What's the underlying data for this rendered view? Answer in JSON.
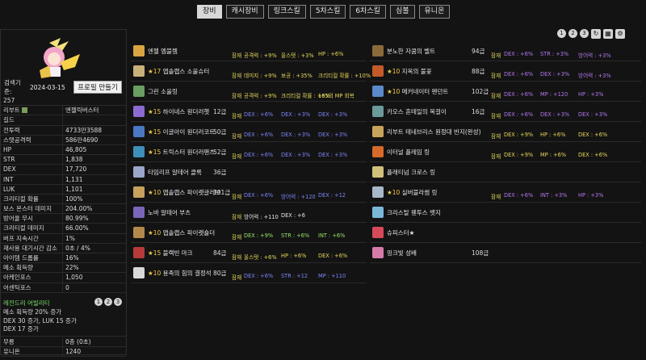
{
  "tabs": [
    "장비",
    "캐시장비",
    "링크스킬",
    "5차스킬",
    "6차스킬",
    "심볼",
    "유니온"
  ],
  "active_tab": 0,
  "search": {
    "label": "검색기준:",
    "date": "2024-03-15"
  },
  "profile_button": "프로필 만들기",
  "stats": [
    {
      "k": "257",
      "v": "",
      "single": true
    },
    {
      "k": "리부트",
      "v": "엔젤릭버스터",
      "emblem": true
    },
    {
      "k": "길드",
      "v": ""
    },
    {
      "k": "전투력",
      "v": "4733만3588"
    },
    {
      "k": "스탯공격력",
      "v": "586만4690"
    },
    {
      "k": "HP",
      "v": "46,805"
    },
    {
      "k": "STR",
      "v": "1,838"
    },
    {
      "k": "DEX",
      "v": "17,720"
    },
    {
      "k": "INT",
      "v": "1,131"
    },
    {
      "k": "LUK",
      "v": "1,101"
    },
    {
      "k": "크리티컬 확률",
      "v": "100%"
    },
    {
      "k": "보스 몬스터 데미지",
      "v": "204.00%"
    },
    {
      "k": "방어율 무시",
      "v": "80.99%"
    },
    {
      "k": "크리티컬 데미지",
      "v": "66.00%"
    },
    {
      "k": "버프 지속시간",
      "v": "1%"
    },
    {
      "k": "재사용 대기시간 감소",
      "v": "0초 / 4%"
    },
    {
      "k": "아이템 드롭률",
      "v": "16%"
    },
    {
      "k": "메소 획득량",
      "v": "22%"
    },
    {
      "k": "아케인포스",
      "v": "1,050"
    },
    {
      "k": "어센틱포스",
      "v": "0"
    }
  ],
  "legend": {
    "title": "레전드리 어빌리티",
    "nums": [
      "1",
      "2",
      "3"
    ],
    "lines": [
      "메소 획득량 20% 증가",
      "DEX 30 증가, LUK 15 증가",
      "DEX 17 증가"
    ]
  },
  "bottom_stats": [
    {
      "k": "무릉",
      "v": "0층 (0초)"
    },
    {
      "k": "유니온",
      "v": "1240",
      "orange": true
    }
  ],
  "top_icons": [
    "1",
    "2",
    "3",
    "↻",
    "▦",
    "⚙"
  ],
  "left_items": [
    {
      "star": "",
      "name": "엔젤 엠블렘",
      "lvl": "",
      "color": "#d9a441",
      "opts": [
        {
          "t": "잠재",
          "c": "tag"
        },
        {
          "t": "공격력 : +9%",
          "c": "yel"
        },
        {
          "t": "올스탯 : +3%",
          "c": "yel"
        },
        {
          "t": "HP : +6%",
          "c": "yel"
        }
      ]
    },
    {
      "star": "★17",
      "name": "앱솔랩스 소울슈터",
      "lvl": "",
      "color": "#c9b27a",
      "opts": [
        {
          "t": "잠재",
          "c": "tag"
        },
        {
          "t": "데미지 : +9%",
          "c": "yel"
        },
        {
          "t": "보공 : +35%",
          "c": "yel"
        },
        {
          "t": "크리티컬 확률 : +10%",
          "c": "yel"
        }
      ]
    },
    {
      "star": "",
      "name": "그린 소울링",
      "lvl": "",
      "color": "#6a9e63",
      "opts": [
        {
          "t": "잠재",
          "c": "tag"
        },
        {
          "t": "공격력 : +9%",
          "c": "yel"
        },
        {
          "t": "크리티컬 확률 : +8%",
          "c": "yel"
        },
        {
          "t": "165의 MP 회복",
          "c": "yel"
        }
      ]
    },
    {
      "star": "★15",
      "name": "하이네스 원더러햇",
      "lvl": "12급",
      "color": "#8b6bd1",
      "opts": [
        {
          "t": "잠재",
          "c": "tag"
        },
        {
          "t": "DEX : +6%",
          "c": "blu"
        },
        {
          "t": "DEX : +3%",
          "c": "blu"
        },
        {
          "t": "DEX : +3%",
          "c": "blu"
        }
      ]
    },
    {
      "star": "★15",
      "name": "이글아이 원더러코트",
      "lvl": "50급",
      "color": "#4b78c2",
      "opts": [
        {
          "t": "잠재",
          "c": "tag"
        },
        {
          "t": "DEX : +6%",
          "c": "blu"
        },
        {
          "t": "DEX : +3%",
          "c": "blu"
        },
        {
          "t": "DEX : +3%",
          "c": "blu"
        }
      ]
    },
    {
      "star": "★15",
      "name": "트릭스터 원더러팬츠",
      "lvl": "52급",
      "color": "#3e8fb8",
      "opts": [
        {
          "t": "잠재",
          "c": "tag"
        },
        {
          "t": "DEX : +6%",
          "c": "blu"
        },
        {
          "t": "DEX : +3%",
          "c": "blu"
        },
        {
          "t": "DEX : +3%",
          "c": "blu"
        }
      ]
    },
    {
      "star": "",
      "name": "타임리프 알테어 클록",
      "lvl": "36급",
      "color": "#9aa7c9",
      "opts": []
    },
    {
      "star": "★10",
      "name": "앱솔랩스 파이렛글러브",
      "lvl": "101급",
      "color": "#c8a15c",
      "opts": [
        {
          "t": "잠재",
          "c": "tag"
        },
        {
          "t": "DEX : +6%",
          "c": "blu"
        },
        {
          "t": "방어력 : +120",
          "c": "blu"
        },
        {
          "t": "DEX : +12",
          "c": "blu"
        }
      ]
    },
    {
      "star": "",
      "name": "노바 알테어 부츠",
      "lvl": "",
      "color": "#7a66b8",
      "opts": [
        {
          "t": "잠재",
          "c": "tag"
        },
        {
          "t": "방어력 : +110",
          "c": "white"
        },
        {
          "t": "DEX : +6",
          "c": "white"
        }
      ]
    },
    {
      "star": "★10",
      "name": "앱솔랩스 파이렛숄더",
      "lvl": "",
      "color": "#b3894b",
      "opts": [
        {
          "t": "잠재",
          "c": "tag"
        },
        {
          "t": "DEX : +9%",
          "c": "grn"
        },
        {
          "t": "STR : +6%",
          "c": "grn"
        },
        {
          "t": "INT : +6%",
          "c": "grn"
        }
      ]
    },
    {
      "star": "★15",
      "name": "블랙빈 마크",
      "lvl": "84급",
      "color": "#b83a3a",
      "opts": [
        {
          "t": "잠재",
          "c": "tag"
        },
        {
          "t": "올스탯 : +6%",
          "c": "yel"
        },
        {
          "t": "HP : +6%",
          "c": "yel"
        },
        {
          "t": "DEX : +6%",
          "c": "yel"
        }
      ]
    },
    {
      "star": "★10",
      "name": "용족의 힘의 결정석",
      "lvl": "80급",
      "color": "#d8d8d8",
      "opts": [
        {
          "t": "잠재",
          "c": "tag"
        },
        {
          "t": "DEX : +6%",
          "c": "blu"
        },
        {
          "t": "STR : +12",
          "c": "blu"
        },
        {
          "t": "MP : +110",
          "c": "blu"
        }
      ]
    }
  ],
  "right_items": [
    {
      "star": "",
      "name": "분노한 자쿰의 벨트",
      "lvl": "94급",
      "color": "#8a6a3a",
      "opts": [
        {
          "t": "잠재",
          "c": "tag"
        },
        {
          "t": "DEX : +6%",
          "c": "pur"
        },
        {
          "t": "STR : +3%",
          "c": "pur"
        },
        {
          "t": "방어력 : +3%",
          "c": "pur"
        }
      ]
    },
    {
      "star": "★10",
      "name": "지옥의 불꽃",
      "lvl": "88급",
      "color": "#c45a2a",
      "opts": [
        {
          "t": "잠재",
          "c": "tag"
        },
        {
          "t": "DEX : +6%",
          "c": "pur"
        },
        {
          "t": "DEX : +3%",
          "c": "pur"
        },
        {
          "t": "방어력 : +3%",
          "c": "pur"
        }
      ]
    },
    {
      "star": "★10",
      "name": "메커네이터 펜던트",
      "lvl": "102급",
      "color": "#5a8ac9",
      "opts": [
        {
          "t": "잠재",
          "c": "tag"
        },
        {
          "t": "DEX : +6%",
          "c": "pur"
        },
        {
          "t": "MP : +120",
          "c": "pur"
        },
        {
          "t": "HP : +3%",
          "c": "pur"
        }
      ]
    },
    {
      "star": "",
      "name": "카오스 혼테일의 목걸이",
      "lvl": "16급",
      "color": "#6a9a9a",
      "opts": [
        {
          "t": "잠재",
          "c": "tag"
        },
        {
          "t": "DEX : +6%",
          "c": "pur"
        },
        {
          "t": "DEX : +3%",
          "c": "pur"
        },
        {
          "t": "DEX : +3%",
          "c": "pur"
        }
      ]
    },
    {
      "star": "",
      "name": "리부트 테네브리스 원정대 반지(완성)",
      "lvl": "",
      "color": "#c8a45a",
      "opts": [
        {
          "t": "잠재",
          "c": "tag"
        },
        {
          "t": "DEX : +9%",
          "c": "yel"
        },
        {
          "t": "HP : +6%",
          "c": "yel"
        },
        {
          "t": "DEX : +6%",
          "c": "yel"
        }
      ]
    },
    {
      "star": "",
      "name": "이터널 플레임 링",
      "lvl": "",
      "color": "#d66a2a",
      "opts": [
        {
          "t": "잠재",
          "c": "tag"
        },
        {
          "t": "DEX : +9%",
          "c": "yel"
        },
        {
          "t": "MP : +6%",
          "c": "yel"
        },
        {
          "t": "DEX : +6%",
          "c": "yel"
        }
      ]
    },
    {
      "star": "",
      "name": "플래티넘 크로스 링",
      "lvl": "",
      "color": "#d0c07a",
      "opts": []
    },
    {
      "star": "★10",
      "name": "실버블라썸 링",
      "lvl": "",
      "color": "#a8b8c8",
      "opts": [
        {
          "t": "잠재",
          "c": "tag"
        },
        {
          "t": "DEX : +6%",
          "c": "pur"
        },
        {
          "t": "INT : +3%",
          "c": "pur"
        },
        {
          "t": "HP : +3%",
          "c": "pur"
        }
      ]
    },
    {
      "star": "",
      "name": "크리스탈 웬투스 뱃지",
      "lvl": "",
      "color": "#7ab8d8",
      "opts": []
    },
    {
      "star": "",
      "name": "슈피스터★",
      "lvl": "",
      "color": "#d84a5a",
      "opts": []
    },
    {
      "star": "",
      "name": "핑크빛 성배",
      "lvl": "108급",
      "color": "#d67aa8",
      "opts": []
    }
  ]
}
